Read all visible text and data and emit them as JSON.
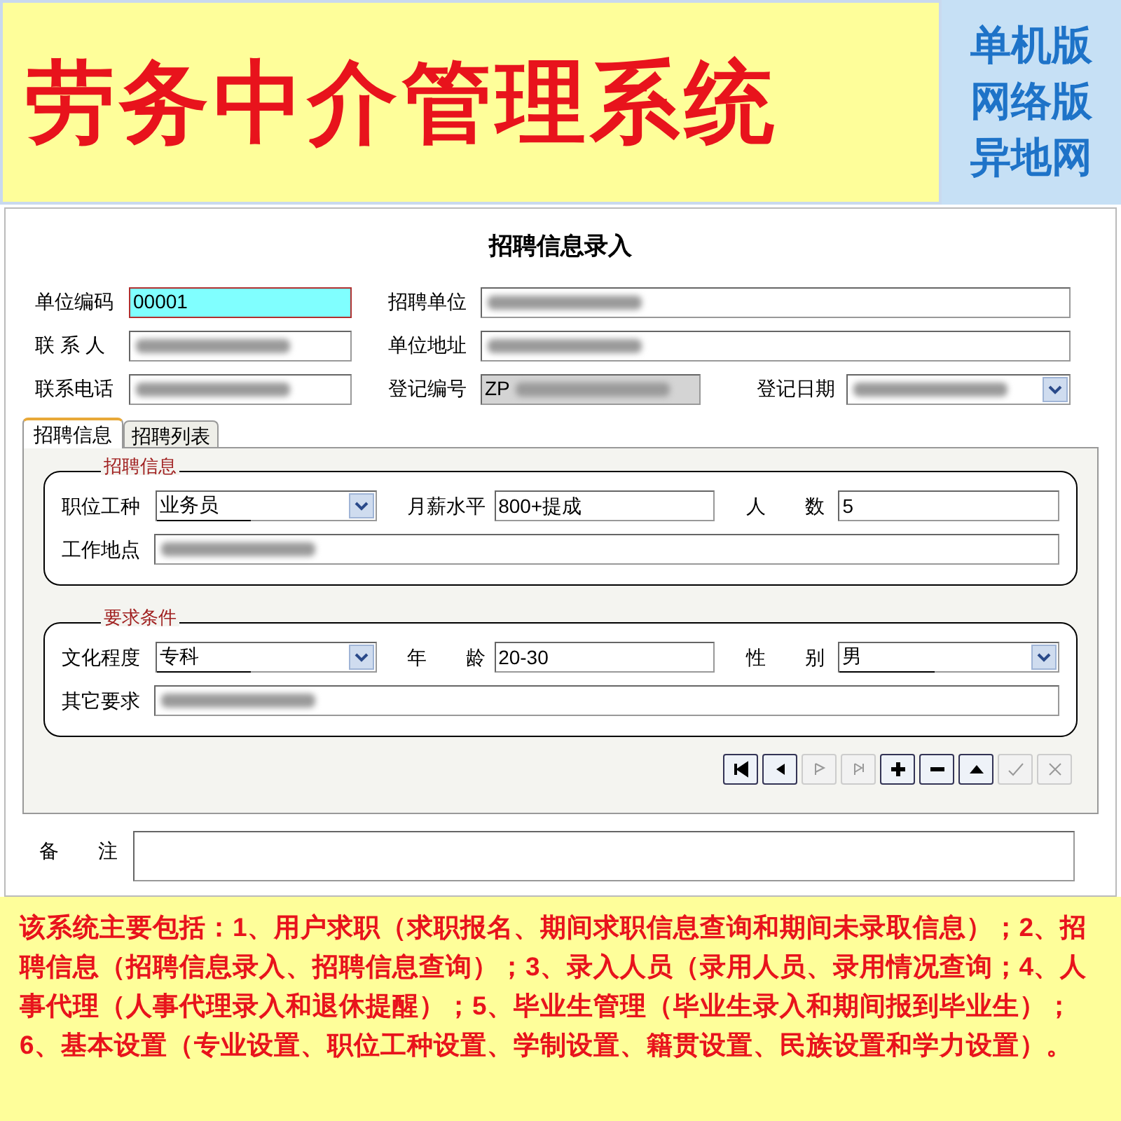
{
  "banner": {
    "title": "劳务中介管理系统",
    "editions": [
      "单机版",
      "网络版",
      "异地网"
    ]
  },
  "form": {
    "title": "招聘信息录入",
    "header_fields": [
      {
        "label": "单位编码",
        "value": "00001",
        "kind": "text",
        "focused": true,
        "blurred": false
      },
      {
        "label": "招聘单位",
        "kind": "text",
        "focused": false,
        "blurred": true
      },
      {
        "label": "联 系 人",
        "kind": "text",
        "focused": false,
        "blurred": true
      },
      {
        "label": "单位地址",
        "kind": "text",
        "focused": false,
        "blurred": true
      },
      {
        "label": "联系电话",
        "kind": "text",
        "focused": false,
        "blurred": true
      },
      {
        "label": "登记编号",
        "value": "ZP",
        "kind": "readonly",
        "focused": false,
        "blurred": true
      },
      {
        "label": "登记日期",
        "kind": "date",
        "focused": false,
        "blurred": true
      }
    ],
    "tabs": [
      {
        "label": "招聘信息",
        "selected": true
      },
      {
        "label": "招聘列表",
        "selected": false
      }
    ],
    "groups": [
      {
        "legend": "招聘信息",
        "rows": [
          [
            {
              "label": "职位工种",
              "value": "业务员",
              "kind": "select",
              "blurred": false
            },
            {
              "label": "月薪水平",
              "value": "800+提成",
              "kind": "text",
              "blurred": false
            },
            {
              "label": "人　　数",
              "value": "5",
              "kind": "text",
              "blurred": false
            }
          ],
          [
            {
              "label": "工作地点",
              "kind": "wide",
              "blurred": true
            }
          ]
        ]
      },
      {
        "legend": "要求条件",
        "rows": [
          [
            {
              "label": "文化程度",
              "value": "专科",
              "kind": "select",
              "blurred": false
            },
            {
              "label": "年　　龄",
              "value": "20-30",
              "kind": "text",
              "blurred": false
            },
            {
              "label": "性　　别",
              "value": "男",
              "kind": "select",
              "blurred": false
            }
          ],
          [
            {
              "label": "其它要求",
              "kind": "wide",
              "blurred": true
            }
          ]
        ]
      }
    ],
    "nav_buttons": [
      {
        "kind": "first",
        "disabled": false
      },
      {
        "kind": "prev",
        "disabled": false
      },
      {
        "kind": "next",
        "disabled": true
      },
      {
        "kind": "last",
        "disabled": true
      },
      {
        "kind": "add",
        "disabled": false
      },
      {
        "kind": "delete",
        "disabled": false
      },
      {
        "kind": "edit",
        "disabled": false
      },
      {
        "kind": "save",
        "disabled": true
      },
      {
        "kind": "cancel",
        "disabled": true
      }
    ],
    "remark": {
      "label": "备　　注"
    }
  },
  "description": "该系统主要包括：1、用户求职（求职报名、期间求职信息查询和期间未录取信息）；2、招聘信息（招聘信息录入、招聘信息查询）；3、录入人员（录用人员、录用情况查询；4、人事代理（人事代理录入和退休提醒）；5、毕业生管理（毕业生录入和期间报到毕业生）；6、基本设置（专业设置、职位工种设置、学制设置、籍贯设置、民族设置和学力设置）。"
}
